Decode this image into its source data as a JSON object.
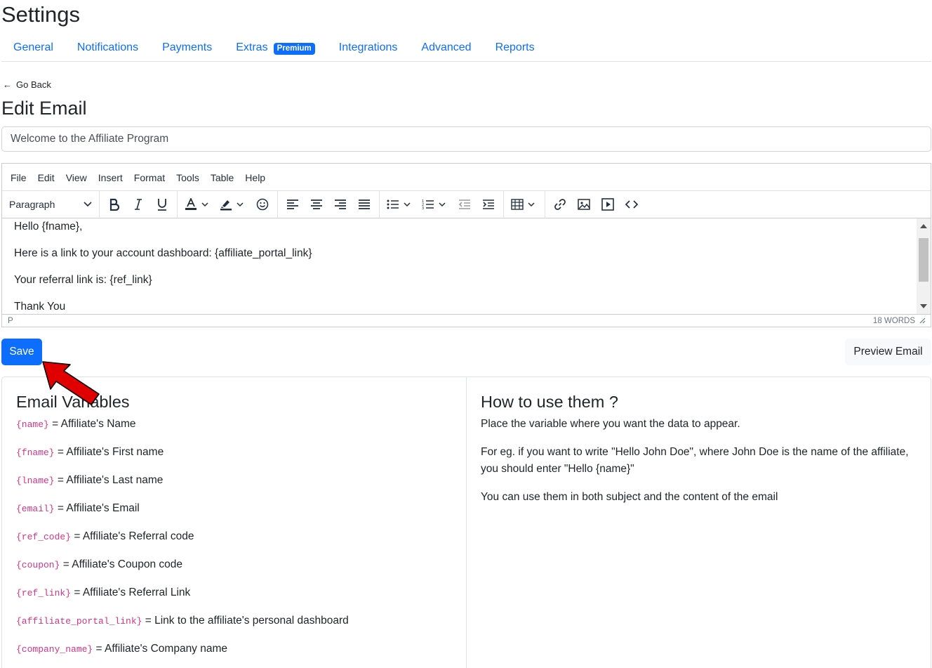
{
  "page": {
    "title": "Settings"
  },
  "tabs": [
    {
      "label": "General"
    },
    {
      "label": "Notifications"
    },
    {
      "label": "Payments"
    },
    {
      "label": "Extras",
      "badge": "Premium"
    },
    {
      "label": "Integrations"
    },
    {
      "label": "Advanced"
    },
    {
      "label": "Reports"
    }
  ],
  "nav": {
    "go_back": "Go Back"
  },
  "editor_page": {
    "title": "Edit Email",
    "subject_value": "Welcome to the Affiliate Program"
  },
  "editor": {
    "menu": [
      "File",
      "Edit",
      "View",
      "Insert",
      "Format",
      "Tools",
      "Table",
      "Help"
    ],
    "block_format": "Paragraph",
    "content": [
      "Hello {fname},",
      "Here is a link to your account dashboard: {affiliate_portal_link}",
      "Your referral link is: {ref_link}",
      "Thank You"
    ],
    "status_path": "P",
    "word_count": "18 WORDS"
  },
  "actions": {
    "save": "Save",
    "preview": "Preview Email"
  },
  "variables": {
    "heading": "Email Variables",
    "items": [
      {
        "code": "{name}",
        "desc": "= Affiliate's Name"
      },
      {
        "code": "{fname}",
        "desc": "= Affiliate's First name"
      },
      {
        "code": "{lname}",
        "desc": "= Affiliate's Last name"
      },
      {
        "code": "{email}",
        "desc": "= Affiliate's Email"
      },
      {
        "code": "{ref_code}",
        "desc": "= Affiliate's Referral code"
      },
      {
        "code": "{coupon}",
        "desc": "= Affiliate's Coupon code"
      },
      {
        "code": "{ref_link}",
        "desc": "= Affiliate's Referral Link"
      },
      {
        "code": "{affiliate_portal_link}",
        "desc": "= Link to the affiliate's personal dashboard"
      },
      {
        "code": "{company_name}",
        "desc": "= Affiliate's Company name"
      }
    ]
  },
  "help": {
    "heading": "How to use them ?",
    "paragraphs": [
      "Place the variable where you want the data to appear.",
      "For eg. if you want to write \"Hello John Doe\", where John Doe is the name of the affiliate, you should enter \"Hello {name}\"",
      "You can use them in both subject and the content of the email"
    ]
  },
  "colors": {
    "primary": "#0d6efd",
    "code": "#d63384",
    "pointer": "#e00000"
  }
}
